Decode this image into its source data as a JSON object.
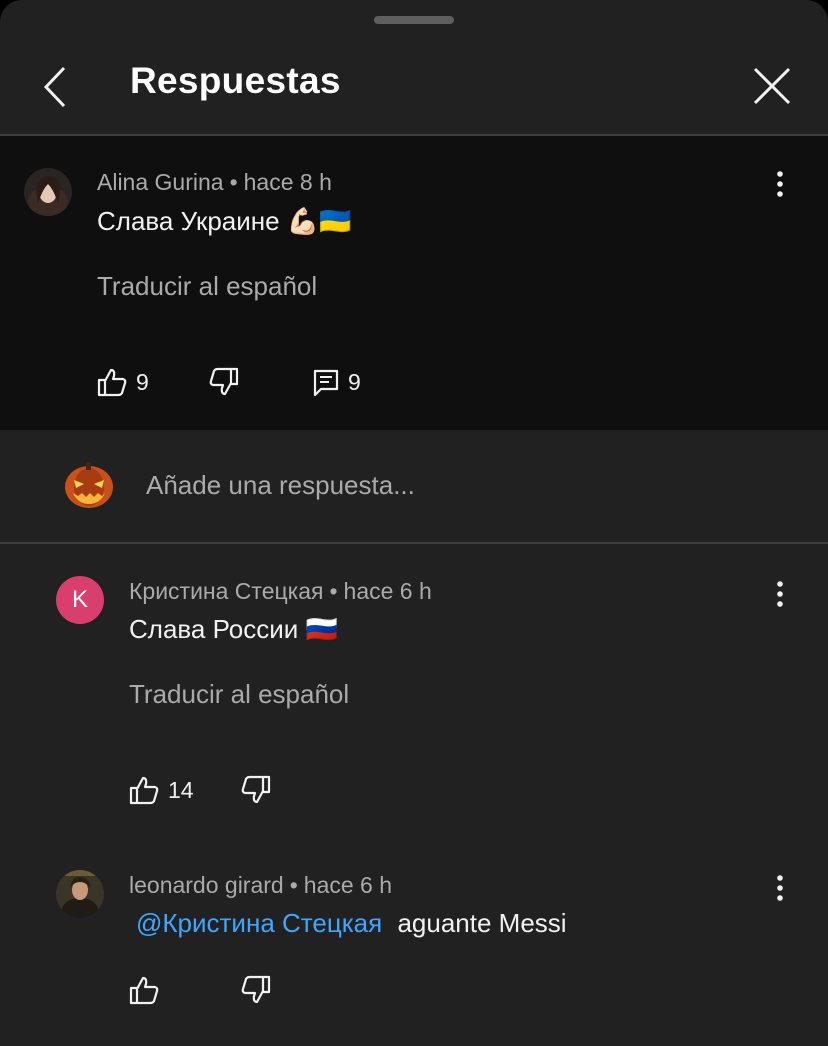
{
  "header": {
    "title": "Respuestas"
  },
  "parent_comment": {
    "author": "Alina Gurina",
    "time": "hace 8 h",
    "text": "Слава Украине 💪🏻🇺🇦",
    "translate": "Traducir al español",
    "likes": "9",
    "replies": "9"
  },
  "composer": {
    "placeholder": "Añade una respuesta..."
  },
  "replies": [
    {
      "author": "Кристина Стецкая",
      "avatar_letter": "K",
      "time": "hace 6 h",
      "text": "Слава России 🇷🇺",
      "translate": "Traducir al español",
      "likes": "14"
    },
    {
      "author": "leonardo girard",
      "time": "hace 6 h",
      "mention": "@Кристина Стецкая",
      "text": "aguante Messi"
    }
  ],
  "separator": "•",
  "icons": {
    "back": "chevron-left-icon",
    "close": "close-icon",
    "more": "more-vertical-icon",
    "like": "thumbs-up-icon",
    "dislike": "thumbs-down-icon",
    "reply": "comment-icon"
  },
  "colors": {
    "background": "#212121",
    "parent_background": "#0f0f0f",
    "mention": "#3ea6ff",
    "avatar_k": "#d83e6e"
  }
}
